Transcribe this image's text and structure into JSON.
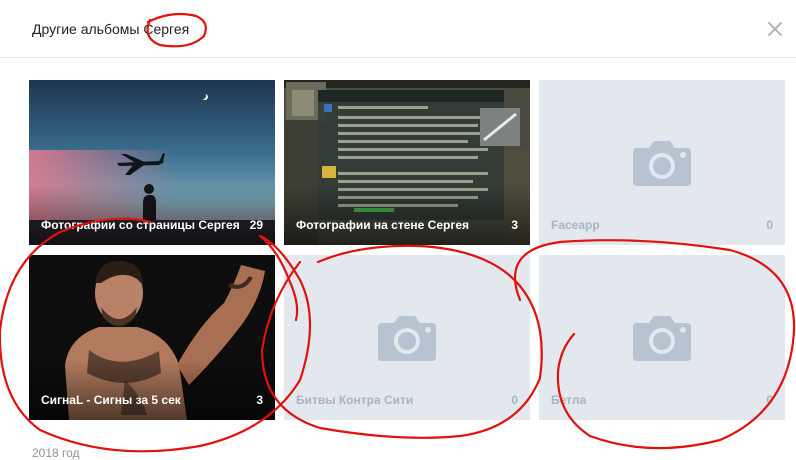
{
  "modal": {
    "title": "Другие альбомы Сергея",
    "close_icon": "close-icon"
  },
  "albums": [
    {
      "name": "Фотографии со страницы Сергея",
      "count": "29",
      "cover": "photo-airplane-sunset"
    },
    {
      "name": "Фотографии на стене Сергея",
      "count": "3",
      "cover": "photo-game-scoreboard"
    },
    {
      "name": "Faceapp",
      "count": "0",
      "cover": "camera-icon"
    },
    {
      "name": "СигнаL - Сигны за 5 сек",
      "count": "3",
      "cover": "photo-fighter"
    },
    {
      "name": "Битвы Контра Сити",
      "count": "0",
      "cover": "camera-icon"
    },
    {
      "name": "Бетла",
      "count": "0",
      "cover": "camera-icon"
    }
  ],
  "footer": {
    "year_label": "2018 год"
  },
  "colors": {
    "empty_bg": "#e3e8ef",
    "empty_icon": "#b7c3d1",
    "annotation": "#e0120c"
  }
}
